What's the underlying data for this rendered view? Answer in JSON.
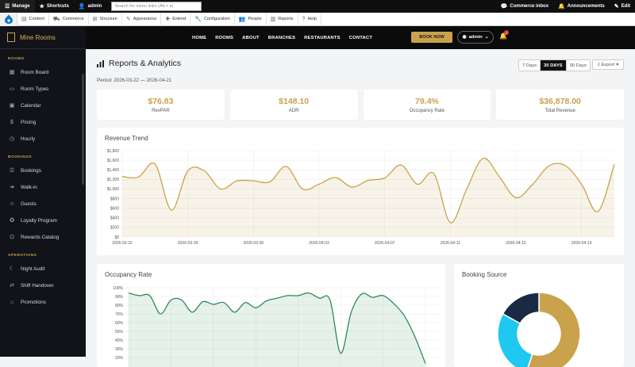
{
  "toolbar": {
    "manage": "Manage",
    "shortcuts": "Shortcuts",
    "user": "admin",
    "search_placeholder": "Search for menu links (Alt + a)",
    "commerce_inbox": "Commerce inbox",
    "announcements": "Announcements",
    "edit": "Edit"
  },
  "tray": {
    "items": [
      "Content",
      "Commerce",
      "Structure",
      "Appearance",
      "Extend",
      "Configuration",
      "People",
      "Reports",
      "Help"
    ]
  },
  "sidebar": {
    "brand": "Mine Rooms",
    "sections": [
      {
        "title": "ROOMS",
        "items": [
          "Room Board",
          "Room Types",
          "Calendar",
          "Pricing",
          "Hourly"
        ]
      },
      {
        "title": "BOOKINGS",
        "items": [
          "Bookings",
          "Walk-in",
          "Guests",
          "Loyalty Program",
          "Rewards Catalog"
        ]
      },
      {
        "title": "OPERATIONS",
        "items": [
          "Night Audit",
          "Shift Handover",
          "Promotions"
        ]
      }
    ]
  },
  "header": {
    "nav": [
      "HOME",
      "ROOMS",
      "ABOUT",
      "BRANCHES",
      "RESTAURANTS",
      "CONTACT"
    ],
    "book_now": "BOOK NOW",
    "user": "admin",
    "notifications": "1"
  },
  "page": {
    "title": "Reports & Analytics",
    "period": "Period: 2026-03-22 — 2026-04-21",
    "ranges": [
      "7 Days",
      "30 DAYS",
      "90 Days"
    ],
    "active_range": "30 DAYS",
    "export": "Export"
  },
  "kpis": [
    {
      "value": "$76.83",
      "label": "RevPAR"
    },
    {
      "value": "$148.10",
      "label": "ADR"
    },
    {
      "value": "79.4%",
      "label": "Occupancy Rate"
    },
    {
      "value": "$36,878.00",
      "label": "Total Revenue"
    }
  ],
  "colors": {
    "accent": "#c9a24b",
    "occupancy": "#2e8b57",
    "dark": "#111318",
    "cyan": "#1ec8f0",
    "navy": "#1b2a44"
  },
  "chart_data": [
    {
      "type": "area",
      "title": "Revenue Trend",
      "ylim": [
        0,
        1800
      ],
      "yticks": [
        "$1,800",
        "$1,600",
        "$1,400",
        "$1,200",
        "$1,000",
        "$800",
        "$600",
        "$400",
        "$200",
        "$0"
      ],
      "xtick_labels": [
        "2026-03-22",
        "2026-03-26",
        "2026-03-30",
        "2026-04-03",
        "2026-04-07",
        "2026-04-11",
        "2026-04-15",
        "2026-04-19"
      ],
      "x": [
        "2026-03-22",
        "2026-03-23",
        "2026-03-24",
        "2026-03-25",
        "2026-03-26",
        "2026-03-27",
        "2026-03-28",
        "2026-03-29",
        "2026-03-30",
        "2026-03-31",
        "2026-04-01",
        "2026-04-02",
        "2026-04-03",
        "2026-04-04",
        "2026-04-05",
        "2026-04-06",
        "2026-04-07",
        "2026-04-08",
        "2026-04-09",
        "2026-04-10",
        "2026-04-11",
        "2026-04-12",
        "2026-04-13",
        "2026-04-14",
        "2026-04-15",
        "2026-04-16",
        "2026-04-17",
        "2026-04-18",
        "2026-04-19",
        "2026-04-20",
        "2026-04-21"
      ],
      "values": [
        1260,
        1250,
        1520,
        560,
        1380,
        1380,
        1000,
        1170,
        1170,
        1150,
        1470,
        1000,
        1100,
        1240,
        1040,
        1180,
        1230,
        1500,
        1100,
        1320,
        300,
        1000,
        1640,
        1250,
        820,
        1090,
        1480,
        1490,
        1100,
        530,
        1520
      ],
      "grid": true
    },
    {
      "type": "area",
      "title": "Occupancy Rate",
      "ylim": [
        0,
        100
      ],
      "yticks": [
        "100%",
        "90%",
        "80%",
        "70%",
        "60%",
        "50%",
        "40%",
        "30%",
        "20%"
      ],
      "values": [
        94,
        91,
        91,
        70,
        86,
        86,
        72,
        84,
        81,
        83,
        72,
        83,
        77,
        85,
        88,
        91,
        91,
        94,
        88,
        86,
        25,
        72,
        93,
        89,
        91,
        82,
        68,
        44,
        13
      ],
      "grid": true
    },
    {
      "type": "pie",
      "title": "Booking Source",
      "values": [
        55,
        28,
        17
      ],
      "colors": [
        "#c9a24b",
        "#1ec8f0",
        "#1b2a44"
      ]
    }
  ]
}
